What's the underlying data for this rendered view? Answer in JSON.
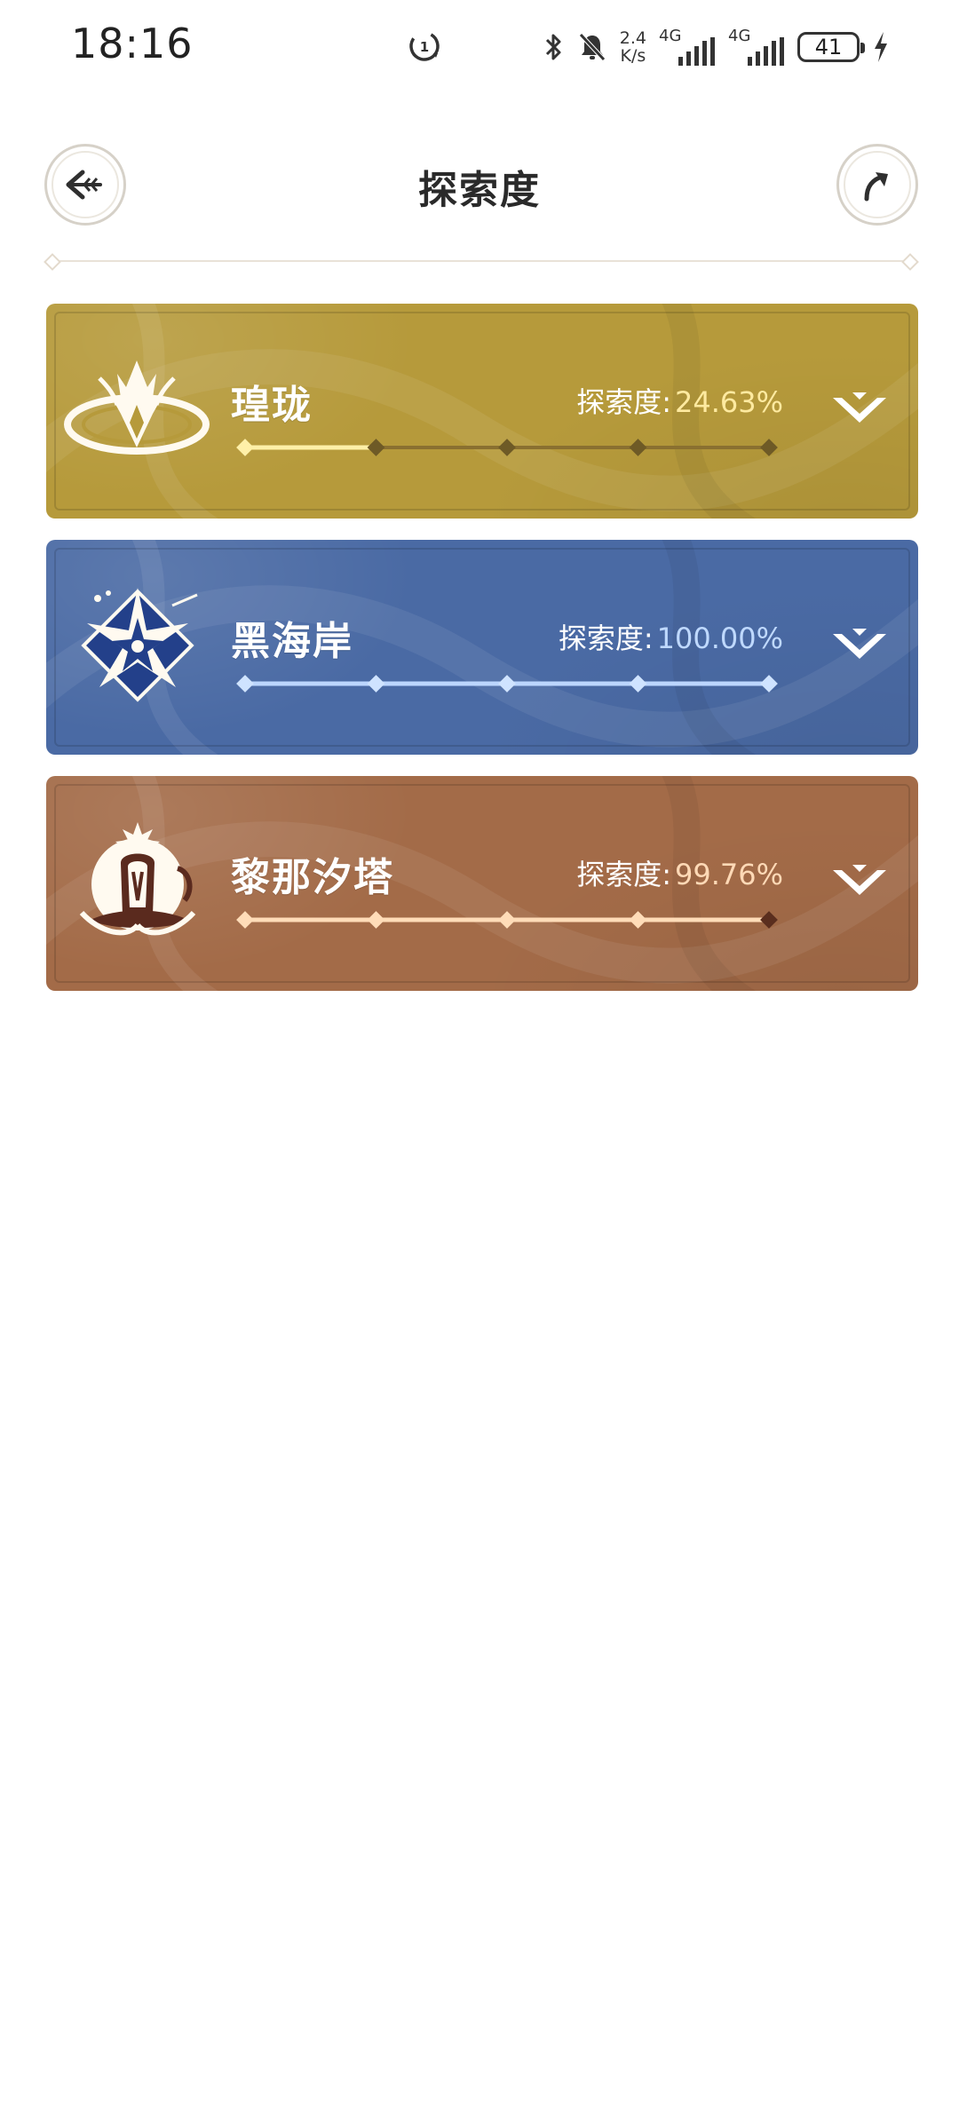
{
  "status_bar": {
    "time": "18:16",
    "net_speed_value": "2.4",
    "net_speed_unit": "K/s",
    "sim1_label": "4G",
    "sim2_label": "4G",
    "battery_level": "41",
    "icons": [
      "data-saver-icon",
      "bluetooth-icon",
      "mute-icon",
      "signal-icon",
      "battery-icon",
      "charging-icon"
    ]
  },
  "header": {
    "title": "探索度",
    "back_icon": "back-arrow-icon",
    "share_icon": "share-arrow-icon"
  },
  "regions": [
    {
      "name": "瑝珑",
      "progress_label": "探索度:",
      "progress_text": "24.63%",
      "progress": 0.2463,
      "theme": {
        "bg": "#b69a3b",
        "track": "#8a7030",
        "fill": "#fff0a8",
        "marker": "#6e5a26",
        "active_marker": "#fff0a8"
      },
      "emblem_icon": "dragon-emblem-icon"
    },
    {
      "name": "黑海岸",
      "progress_label": "探索度:",
      "progress_text": "100.00%",
      "progress": 1.0,
      "theme": {
        "bg": "#4a6aa4",
        "track": "#bcd6ff",
        "fill": "#bcd6ff",
        "marker": "#cfe3ff",
        "active_marker": "#cfe3ff"
      },
      "emblem_icon": "star-flower-emblem-icon"
    },
    {
      "name": "黎那汐塔",
      "progress_label": "探索度:",
      "progress_text": "99.76%",
      "progress": 0.9976,
      "theme": {
        "bg": "#a36b48",
        "track": "#ffdcb8",
        "fill": "#ffdcb8",
        "marker": "#ffdcb8",
        "active_marker": "#ffdcb8",
        "end_marker": "#5a2e1e"
      },
      "emblem_icon": "bell-tower-emblem-icon"
    }
  ]
}
